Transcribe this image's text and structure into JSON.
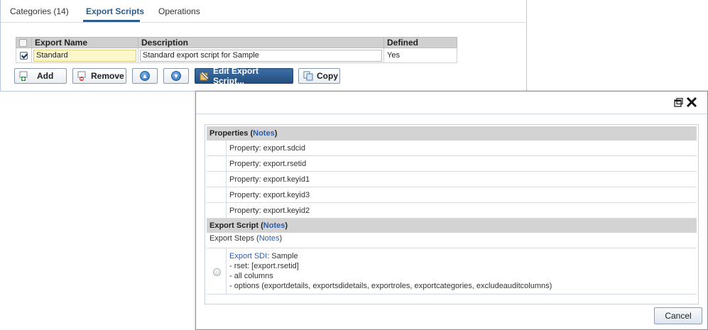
{
  "tabs": [
    {
      "label": "Categories (14)"
    },
    {
      "label": "Export Scripts"
    },
    {
      "label": "Operations"
    }
  ],
  "grid": {
    "headers": {
      "name": "Export Name",
      "description": "Description",
      "defined": "Defined"
    },
    "rows": [
      {
        "checked": true,
        "name": "Standard",
        "description": "Standard export script for Sample",
        "defined": "Yes"
      }
    ]
  },
  "toolbar": {
    "add": "Add",
    "remove": "Remove",
    "edit": "Edit Export Script...",
    "copy": "Copy"
  },
  "dialog": {
    "properties_title": "Properties (",
    "notes": "Notes",
    "close_paren": ")",
    "properties": [
      "Property: export.sdcid",
      "Property: export.rsetid",
      "Property: export.keyid1",
      "Property: export.keyid3",
      "Property: export.keyid2"
    ],
    "script_title": "Export Script (",
    "steps_label": "Export Steps (",
    "step": {
      "link": "Export SDI",
      "suffix": ": Sample",
      "lines": [
        "- rset: [export.rsetid]",
        "- all columns",
        "- options (exportdetails, exportsdidetails, exportroles, exportcategories, excludeauditcolumns)"
      ]
    },
    "cancel": "Cancel"
  },
  "colors": {
    "accent": "#2c5b8e",
    "link": "#2a5db0",
    "primary_button": "#2a5687"
  }
}
